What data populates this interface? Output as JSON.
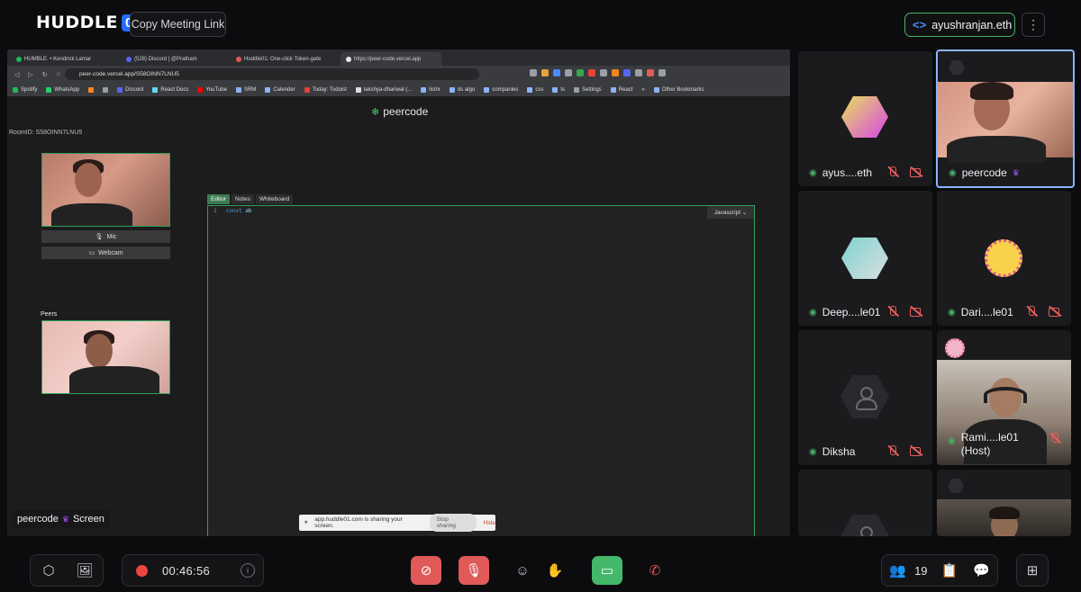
{
  "header": {
    "logo_word": "HUDDLE",
    "logo_badge": "01",
    "copy_link_label": "Copy Meeting Link",
    "username": "ayushranjan.eth"
  },
  "browser": {
    "tabs": [
      {
        "label": "HUMBLE. • Kendrick Lamar",
        "color": "#1db954"
      },
      {
        "label": "(528) Discord | @Pratham",
        "color": "#5865f2"
      },
      {
        "label": "Huddle01: One-click Token-gate",
        "color": "#e05a5a"
      },
      {
        "label": "https://peer-code.vercel.app",
        "color": "#e8e8e8"
      }
    ],
    "url": "peer-code.vercel.app/S58OINN7LNU5",
    "bookmarks": [
      "Spotify",
      "WhatsApp",
      "Discord",
      "React Docs",
      "YouTube",
      "SRM",
      "Calender",
      "Today: Todoist",
      "lakshya-dhariwal (...",
      "listnr",
      "ds algo",
      "companies",
      "css",
      "ts",
      "Settings",
      "React",
      "Other Bookmarks"
    ]
  },
  "peercode": {
    "title": "peercode",
    "room_id": "RoomID: S58OINN7LNU5",
    "mic_label": "Mic",
    "webcam_label": "Webcam",
    "peers_label": "Peers",
    "editor_tabs": [
      "Editor",
      "Notes",
      "Whiteboard"
    ],
    "language": "Javascript",
    "code_line_no": "1",
    "code_keyword": "const",
    "code_rest": "ab",
    "share_notice": "app.huddle01.com is sharing your screen.",
    "stop_sharing": "Stop sharing",
    "hide": "Hide"
  },
  "screen_label": {
    "name": "peercode",
    "suffix": "Screen"
  },
  "participants": [
    {
      "name": "ayus....eth"
    },
    {
      "name": "peercode"
    },
    {
      "name": "Deep....le01"
    },
    {
      "name": "Dari....le01"
    },
    {
      "name": "Diksha"
    },
    {
      "name": "Rami....le01",
      "role": "(Host)"
    }
  ],
  "controls": {
    "timer": "00:46:56",
    "participant_count": "19"
  },
  "colors": {
    "accent_blue": "#246bfd",
    "mute_red": "#e05a5a",
    "share_green": "#44b86a",
    "online_green": "#46b06a"
  }
}
